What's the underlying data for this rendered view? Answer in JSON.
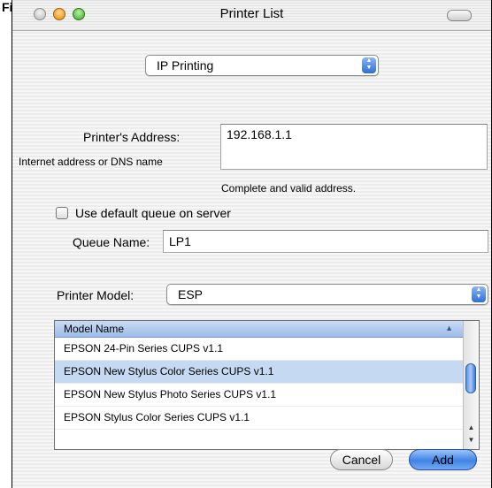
{
  "figure_label": "Figure",
  "window": {
    "title": "Printer List"
  },
  "connection": {
    "selected": "IP Printing"
  },
  "address": {
    "label": "Printer's Address:",
    "sublabel": "Internet address or DNS name",
    "value": "192.168.1.1",
    "status": "Complete and valid address."
  },
  "queue": {
    "default_checkbox_label": "Use default queue on server",
    "default_checked": false,
    "name_label": "Queue Name:",
    "name_value": "LP1"
  },
  "model": {
    "label": "Printer Model:",
    "selected": "ESP"
  },
  "model_table": {
    "column_header": "Model Name",
    "rows": [
      "EPSON 24-Pin Series CUPS v1.1",
      "EPSON New Stylus Color Series CUPS v1.1",
      "EPSON New Stylus Photo Series CUPS v1.1",
      "EPSON Stylus Color Series CUPS v1.1"
    ],
    "selected_index": 1
  },
  "buttons": {
    "cancel": "Cancel",
    "add": "Add"
  },
  "icons": {
    "close": "close-button-icon",
    "minimize": "minimize-button-icon",
    "zoom": "zoom-button-icon",
    "toolbar": "toolbar-toggle-icon",
    "popup": "popup-arrows-icon",
    "sort": "sort-ascending-icon"
  },
  "colors": {
    "selection": "#c6d9f3",
    "header": "#9dbbe8",
    "default_button": "#3f82e6"
  }
}
